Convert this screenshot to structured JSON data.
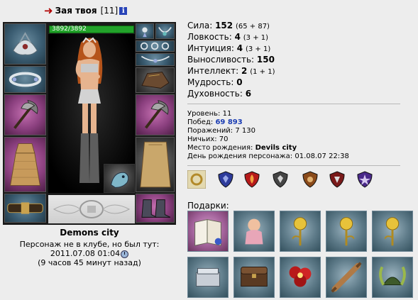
{
  "header": {
    "name": "Зая твоя",
    "level": "[11]",
    "info_icon": "i"
  },
  "character": {
    "hp": "3892/3892",
    "city": "Demons city",
    "offline_text": "Персонаж не в клубе, но был тут:",
    "last_seen": "2011.07.08 01:04",
    "ago": "(9 часов 45 минут назад)"
  },
  "stats": [
    {
      "label": "Сила:",
      "value": "152",
      "bonus": "(65 + 87)"
    },
    {
      "label": "Ловкость:",
      "value": "4",
      "bonus": "(3 + 1)"
    },
    {
      "label": "Интуиция:",
      "value": "4",
      "bonus": "(3 + 1)"
    },
    {
      "label": "Выносливость:",
      "value": "150",
      "bonus": ""
    },
    {
      "label": "Интеллект:",
      "value": "2",
      "bonus": "(1 + 1)"
    },
    {
      "label": "Мудрость:",
      "value": "0",
      "bonus": ""
    },
    {
      "label": "Духовность:",
      "value": "6",
      "bonus": ""
    }
  ],
  "info": {
    "level_label": "Уровень:",
    "level_value": "11",
    "wins_label": "Побед:",
    "wins_value": "69 893",
    "losses_label": "Поражений:",
    "losses_value": "7 130",
    "draws_label": "Ничьих:",
    "draws_value": "70",
    "birthplace_label": "Место рождения:",
    "birthplace_value": "Devils city",
    "birthday_label": "День рождения персонажа:",
    "birthday_value": "01.08.07 22:38"
  },
  "badges": [
    "ring-badge-icon",
    "shield-badge-icon",
    "fire-badge-icon",
    "shield-badge-icon",
    "shield-badge-icon",
    "shield-badge-icon",
    "star-badge-icon"
  ],
  "gifts_label": "Подарки:",
  "gifts": [
    "book-gift-icon",
    "doll-gift-icon",
    "golden-rose-gift-icon",
    "golden-rose-gift-icon",
    "golden-rose-gift-icon",
    "box-gift-icon",
    "chest-gift-icon",
    "red-flower-gift-icon",
    "rolling-pin-gift-icon",
    "horned-helmet-gift-icon"
  ],
  "colors": {
    "hp": "#22a22a",
    "wins": "#1a3cb3",
    "slot_blue": "#3b5d72",
    "slot_pink": "#8a3f7e"
  }
}
